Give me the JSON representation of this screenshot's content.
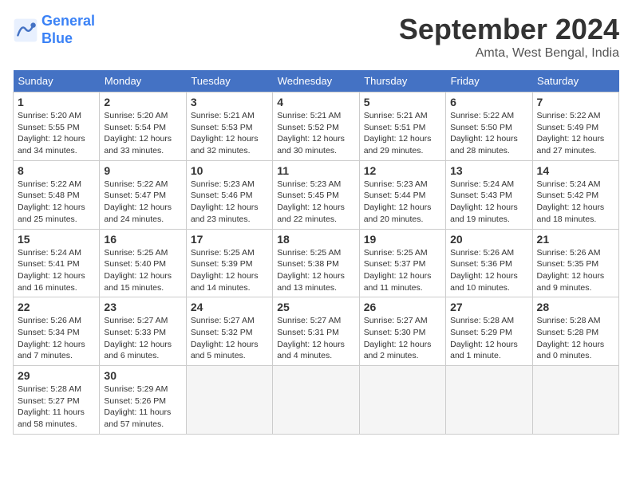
{
  "header": {
    "logo_line1": "General",
    "logo_line2": "Blue",
    "month": "September 2024",
    "location": "Amta, West Bengal, India"
  },
  "columns": [
    "Sunday",
    "Monday",
    "Tuesday",
    "Wednesday",
    "Thursday",
    "Friday",
    "Saturday"
  ],
  "weeks": [
    [
      {
        "day": "1",
        "detail": "Sunrise: 5:20 AM\nSunset: 5:55 PM\nDaylight: 12 hours\nand 34 minutes."
      },
      {
        "day": "2",
        "detail": "Sunrise: 5:20 AM\nSunset: 5:54 PM\nDaylight: 12 hours\nand 33 minutes."
      },
      {
        "day": "3",
        "detail": "Sunrise: 5:21 AM\nSunset: 5:53 PM\nDaylight: 12 hours\nand 32 minutes."
      },
      {
        "day": "4",
        "detail": "Sunrise: 5:21 AM\nSunset: 5:52 PM\nDaylight: 12 hours\nand 30 minutes."
      },
      {
        "day": "5",
        "detail": "Sunrise: 5:21 AM\nSunset: 5:51 PM\nDaylight: 12 hours\nand 29 minutes."
      },
      {
        "day": "6",
        "detail": "Sunrise: 5:22 AM\nSunset: 5:50 PM\nDaylight: 12 hours\nand 28 minutes."
      },
      {
        "day": "7",
        "detail": "Sunrise: 5:22 AM\nSunset: 5:49 PM\nDaylight: 12 hours\nand 27 minutes."
      }
    ],
    [
      {
        "day": "8",
        "detail": "Sunrise: 5:22 AM\nSunset: 5:48 PM\nDaylight: 12 hours\nand 25 minutes."
      },
      {
        "day": "9",
        "detail": "Sunrise: 5:22 AM\nSunset: 5:47 PM\nDaylight: 12 hours\nand 24 minutes."
      },
      {
        "day": "10",
        "detail": "Sunrise: 5:23 AM\nSunset: 5:46 PM\nDaylight: 12 hours\nand 23 minutes."
      },
      {
        "day": "11",
        "detail": "Sunrise: 5:23 AM\nSunset: 5:45 PM\nDaylight: 12 hours\nand 22 minutes."
      },
      {
        "day": "12",
        "detail": "Sunrise: 5:23 AM\nSunset: 5:44 PM\nDaylight: 12 hours\nand 20 minutes."
      },
      {
        "day": "13",
        "detail": "Sunrise: 5:24 AM\nSunset: 5:43 PM\nDaylight: 12 hours\nand 19 minutes."
      },
      {
        "day": "14",
        "detail": "Sunrise: 5:24 AM\nSunset: 5:42 PM\nDaylight: 12 hours\nand 18 minutes."
      }
    ],
    [
      {
        "day": "15",
        "detail": "Sunrise: 5:24 AM\nSunset: 5:41 PM\nDaylight: 12 hours\nand 16 minutes."
      },
      {
        "day": "16",
        "detail": "Sunrise: 5:25 AM\nSunset: 5:40 PM\nDaylight: 12 hours\nand 15 minutes."
      },
      {
        "day": "17",
        "detail": "Sunrise: 5:25 AM\nSunset: 5:39 PM\nDaylight: 12 hours\nand 14 minutes."
      },
      {
        "day": "18",
        "detail": "Sunrise: 5:25 AM\nSunset: 5:38 PM\nDaylight: 12 hours\nand 13 minutes."
      },
      {
        "day": "19",
        "detail": "Sunrise: 5:25 AM\nSunset: 5:37 PM\nDaylight: 12 hours\nand 11 minutes."
      },
      {
        "day": "20",
        "detail": "Sunrise: 5:26 AM\nSunset: 5:36 PM\nDaylight: 12 hours\nand 10 minutes."
      },
      {
        "day": "21",
        "detail": "Sunrise: 5:26 AM\nSunset: 5:35 PM\nDaylight: 12 hours\nand 9 minutes."
      }
    ],
    [
      {
        "day": "22",
        "detail": "Sunrise: 5:26 AM\nSunset: 5:34 PM\nDaylight: 12 hours\nand 7 minutes."
      },
      {
        "day": "23",
        "detail": "Sunrise: 5:27 AM\nSunset: 5:33 PM\nDaylight: 12 hours\nand 6 minutes."
      },
      {
        "day": "24",
        "detail": "Sunrise: 5:27 AM\nSunset: 5:32 PM\nDaylight: 12 hours\nand 5 minutes."
      },
      {
        "day": "25",
        "detail": "Sunrise: 5:27 AM\nSunset: 5:31 PM\nDaylight: 12 hours\nand 4 minutes."
      },
      {
        "day": "26",
        "detail": "Sunrise: 5:27 AM\nSunset: 5:30 PM\nDaylight: 12 hours\nand 2 minutes."
      },
      {
        "day": "27",
        "detail": "Sunrise: 5:28 AM\nSunset: 5:29 PM\nDaylight: 12 hours\nand 1 minute."
      },
      {
        "day": "28",
        "detail": "Sunrise: 5:28 AM\nSunset: 5:28 PM\nDaylight: 12 hours\nand 0 minutes."
      }
    ],
    [
      {
        "day": "29",
        "detail": "Sunrise: 5:28 AM\nSunset: 5:27 PM\nDaylight: 11 hours\nand 58 minutes."
      },
      {
        "day": "30",
        "detail": "Sunrise: 5:29 AM\nSunset: 5:26 PM\nDaylight: 11 hours\nand 57 minutes."
      },
      {
        "day": "",
        "detail": ""
      },
      {
        "day": "",
        "detail": ""
      },
      {
        "day": "",
        "detail": ""
      },
      {
        "day": "",
        "detail": ""
      },
      {
        "day": "",
        "detail": ""
      }
    ]
  ]
}
